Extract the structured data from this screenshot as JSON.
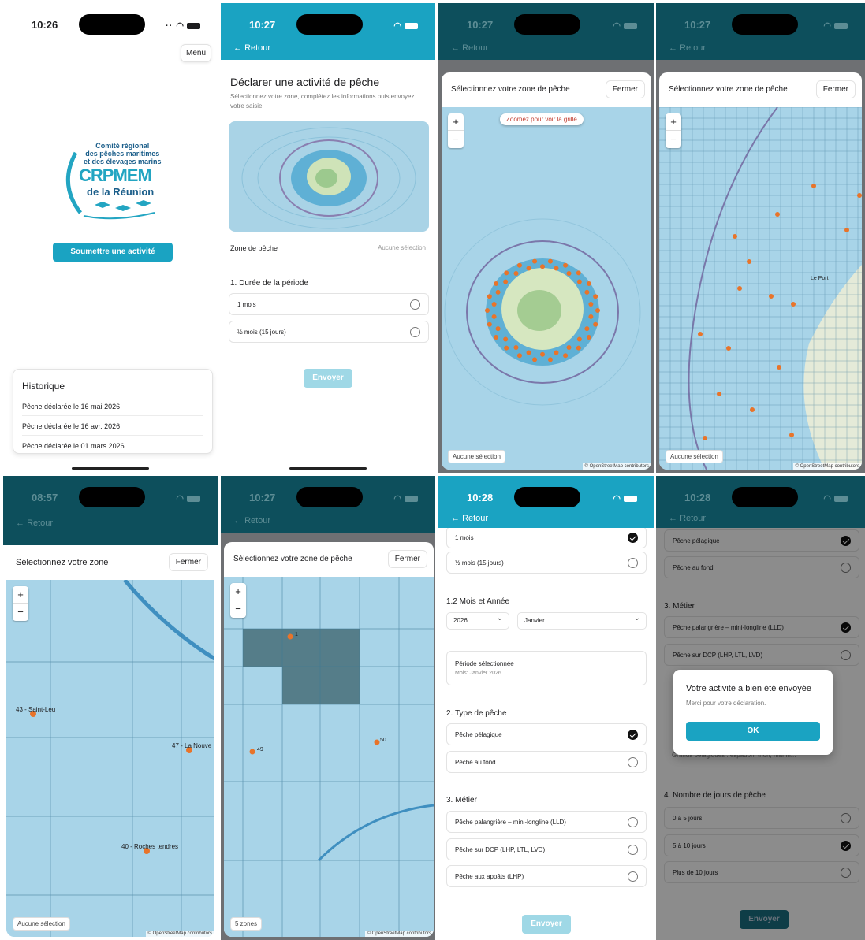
{
  "colors": {
    "accent": "#1aa3c2",
    "dot": "#e8742a",
    "sea": "#a8d4e8"
  },
  "home": {
    "time": "10:26",
    "menu": "Menu",
    "logo": {
      "l1": "Comité régional",
      "l2": "des pêches maritimes",
      "l3": "et des élevages marins",
      "big": "CRPMEM",
      "sub": "de la Réunion"
    },
    "submit": "Soumettre une activité",
    "history_title": "Historique",
    "history": [
      "Pêche déclarée le 16 mai 2026",
      "Pêche déclarée le 16 avr. 2026",
      "Pêche déclarée le 01 mars 2026"
    ]
  },
  "form": {
    "time": "10:27",
    "back": "Retour",
    "title": "Déclarer une activité de pêche",
    "subtitle": "Sélectionnez votre zone, complétez les informations puis envoyez votre saisie.",
    "zone_label": "Zone de pêche",
    "zone_value": "Aucune sélection",
    "duration_title": "1. Durée de la période",
    "opt_1mois": "1 mois",
    "opt_half": "½ mois (15 jours)",
    "send": "Envoyer"
  },
  "map1": {
    "time": "10:27",
    "back": "Retour",
    "title": "Sélectionnez votre zone de pêche",
    "close": "Fermer",
    "hint": "Zoomez pour voir la grille",
    "selection": "Aucune sélection",
    "attrib": "© OpenStreetMap contributors"
  },
  "map2": {
    "time": "10:27",
    "back": "Retour",
    "title": "Sélectionnez votre zone de pêche",
    "close": "Fermer",
    "selection": "Aucune sélection",
    "attrib": "© OpenStreetMap contributors",
    "place": "Le Port"
  },
  "map3": {
    "time": "08:57",
    "back": "Retour",
    "title": "Sélectionnez votre zone",
    "close": "Fermer",
    "selection": "Aucune sélection",
    "attrib": "© OpenStreetMap contributors",
    "labels": [
      "43 - Saint-Leu",
      "47 - La Nouve",
      "40 - Roches tendres"
    ]
  },
  "map4": {
    "time": "10:27",
    "back": "Retour",
    "title": "Sélectionnez votre zone de pêche",
    "close": "Fermer",
    "selection": "5 zones",
    "attrib": "© OpenStreetMap contributors",
    "labels": [
      "1",
      "49",
      "50"
    ]
  },
  "form2": {
    "time": "10:28",
    "back": "Retour",
    "opt_1mois": "1 mois",
    "opt_half": "½ mois (15 jours)",
    "month_title": "1.2 Mois et Année",
    "year": "2026",
    "month": "Janvier",
    "period_title": "Période sélectionnée",
    "period_value": "Mois: Janvier 2026",
    "type_title": "2. Type de pêche",
    "type_pelagique": "Pêche pélagique",
    "type_fond": "Pêche au fond",
    "metier_title": "3. Métier",
    "m1": "Pêche palangrière – mini-longline (LLD)",
    "m2": "Pêche sur DCP (LHP, LTL, LVD)",
    "m3": "Pêche aux appâts (LHP)",
    "send": "Envoyer"
  },
  "done": {
    "time": "10:28",
    "back": "Retour",
    "type_pelagique": "Pêche pélagique",
    "type_fond": "Pêche au fond",
    "metier_title": "3. Métier",
    "m1": "Pêche palangrière – mini-longline (LLD)",
    "m2": "Pêche sur DCP (LHP, LTL, LVD)",
    "species": "Grands pélagiques : espadon, thon, marlin...",
    "days_title": "4. Nombre de jours de pêche",
    "d1": "0 à 5 jours",
    "d2": "5 à 10 jours",
    "d3": "Plus de 10 jours",
    "dialog_title": "Votre activité a bien été envoyée",
    "dialog_msg": "Merci pour votre déclaration.",
    "ok": "OK",
    "send": "Envoyer"
  }
}
